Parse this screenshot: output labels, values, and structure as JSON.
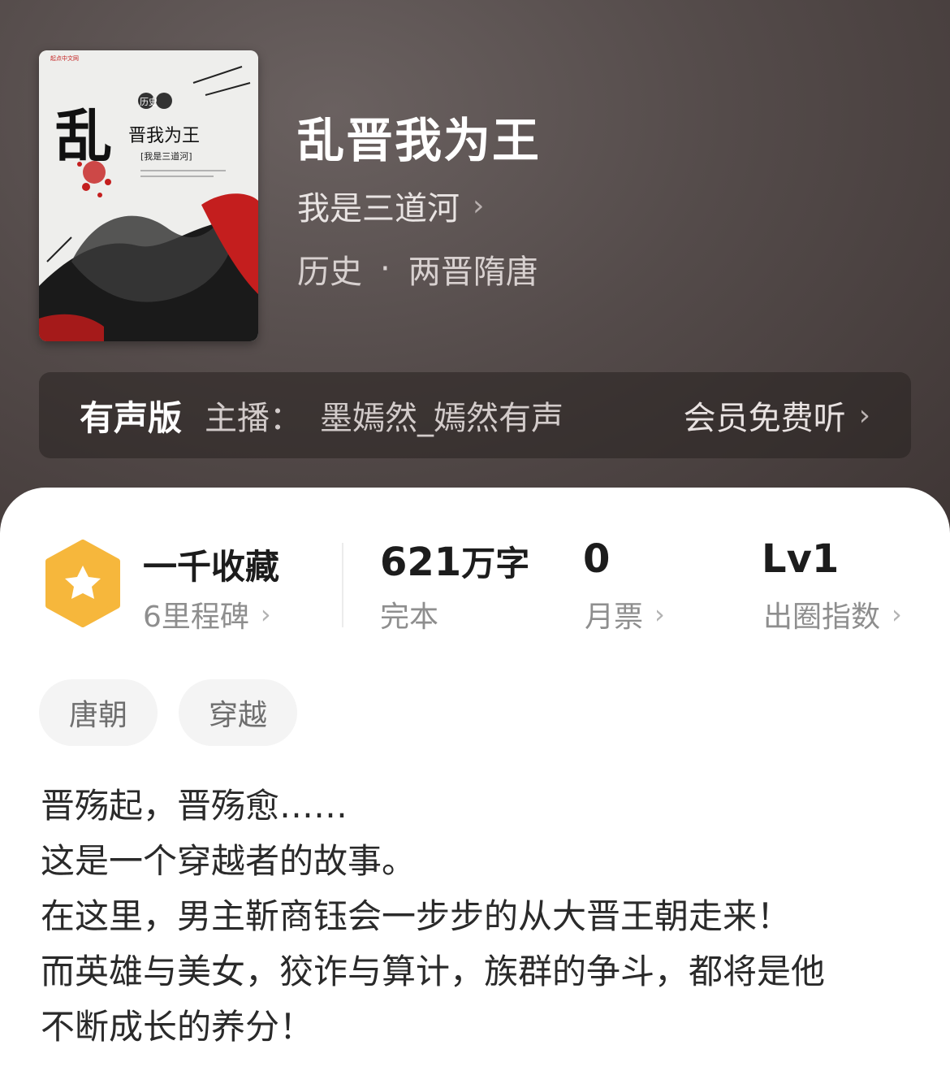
{
  "book": {
    "title": "乱晋我为王",
    "author": "我是三道河",
    "category": "历史",
    "separator": "·",
    "subcategory": "两晋隋唐"
  },
  "cover": {
    "publisher": "起点中文网",
    "genre_seal": "历史",
    "title_big_char": "乱",
    "title_rest": "晋我为王",
    "author_line": "[我是三道河]"
  },
  "audio": {
    "label": "有声版",
    "anchor_prefix": "主播：",
    "anchor_name": "墨嫣然_嫣然有声",
    "action": "会员免费听"
  },
  "stats": {
    "collection": {
      "main": "一千收藏",
      "sub": "6里程碑"
    },
    "words": {
      "number": "621",
      "unit": "万字",
      "sub": "完本"
    },
    "tickets": {
      "number": "0",
      "sub": "月票"
    },
    "index": {
      "number": "Lv1",
      "sub": "出圈指数"
    }
  },
  "tags": [
    "唐朝",
    "穿越"
  ],
  "synopsis": [
    "晋殇起，晋殇愈……",
    "这是一个穿越者的故事。",
    "在这里，男主靳商钰会一步步的从大晋王朝走来！",
    "而英雄与美女，狡诈与算计，族群的争斗，都将是他",
    "不断成长的养分！"
  ],
  "icons": {
    "chevron": "chevron-right-icon",
    "badge": "star-hexagon-icon"
  },
  "colors": {
    "badge": "#f6b73c",
    "hero_bg": "#544b4a",
    "cover_red": "#c41e1e"
  }
}
